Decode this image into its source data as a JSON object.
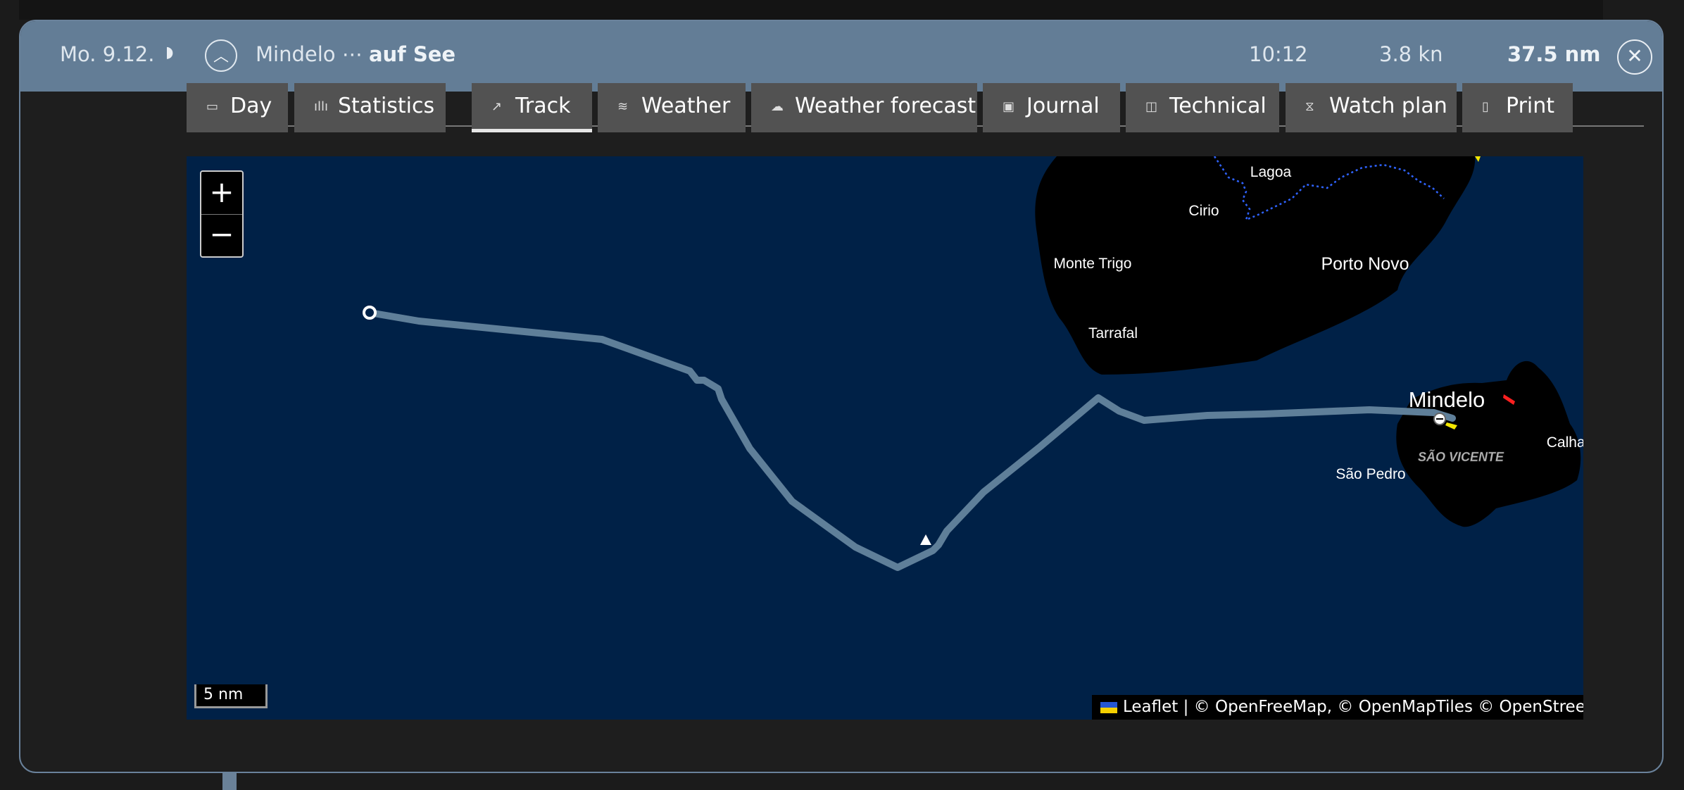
{
  "header": {
    "date": "Mo. 9.12.",
    "moon_icon": "half-moon-icon",
    "route_from": "Mindelo",
    "route_sep": "⋯",
    "route_to": "auf See",
    "time": "10:12",
    "speed": "3.8 kn",
    "distance": "37.5 nm",
    "accent_color": "#637d96"
  },
  "tabs": [
    {
      "label": "Day",
      "icon": "calendar-icon"
    },
    {
      "label": "Statistics",
      "icon": "bar-chart-icon"
    },
    {
      "label": "Track",
      "icon": "track-icon",
      "active": true
    },
    {
      "label": "Weather",
      "icon": "weather-icon"
    },
    {
      "label": "Weather forecast",
      "icon": "cloud-sun-icon"
    },
    {
      "label": "Journal",
      "icon": "journal-icon"
    },
    {
      "label": "Technical",
      "icon": "gauge-icon"
    },
    {
      "label": "Watch plan",
      "icon": "hourglass-icon"
    },
    {
      "label": "Print",
      "icon": "print-icon"
    }
  ],
  "map": {
    "zoom_in": "+",
    "zoom_out": "−",
    "scale": "5 nm",
    "attribution": "Leaflet | © OpenFreeMap, © OpenMapTiles © OpenStreetMap",
    "track_color": "#5f7f99",
    "sea_color": "#002147",
    "labels": {
      "lagoa": "Lagoa",
      "cirio": "Cirio",
      "monte_trigo": "Monte Trigo",
      "porto_novo": "Porto Novo",
      "tarrafal": "Tarrafal",
      "mindelo": "Mindelo",
      "calhau": "Calhau",
      "sao_vicente": "SÃO VICENTE",
      "sao_pedro": "São Pedro"
    }
  }
}
